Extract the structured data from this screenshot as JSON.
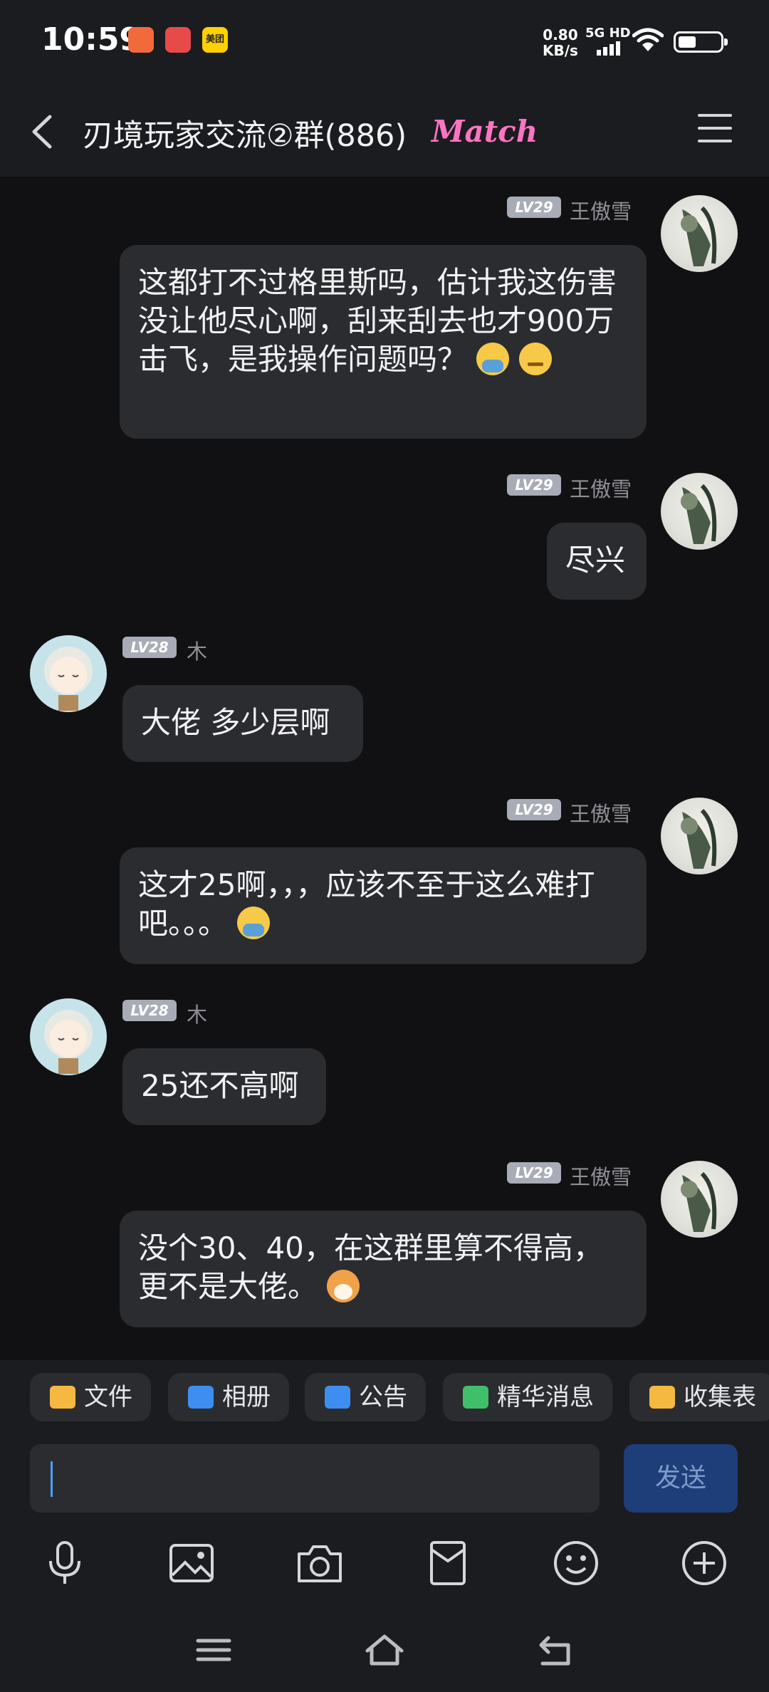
{
  "status_bar": {
    "time": "10:59",
    "net_speed_value": "0.80",
    "net_speed_unit": "KB/s",
    "net_type": "5G HD",
    "notification_apps": [
      "app-icon-1",
      "app-icon-2",
      "meituan-icon"
    ],
    "meituan_label": "美团"
  },
  "header": {
    "title": "刃境玩家交流②群(886)",
    "tag": "Match"
  },
  "messages": [
    {
      "sender": "王傲雪",
      "level": "LV29",
      "text": "这都打不过格里斯吗，估计我这伤害没让他尽心啊，刮来刮去也才900万击飞，是我操作问题吗？"
    },
    {
      "sender": "王傲雪",
      "level": "LV29",
      "text": "尽兴"
    },
    {
      "sender": "木",
      "level": "LV28",
      "text": "大佬 多少层啊"
    },
    {
      "sender": "王傲雪",
      "level": "LV29",
      "text": "这才25啊，，，应该不至于这么难打吧。。。"
    },
    {
      "sender": "木",
      "level": "LV28",
      "text": "25还不高啊"
    },
    {
      "sender": "王傲雪",
      "level": "LV29",
      "text": "没个30、40，在这群里算不得高，更不是大佬。"
    }
  ],
  "quick_actions": [
    {
      "label": "文件",
      "icon": "folder-icon",
      "color": "#f5b942"
    },
    {
      "label": "相册",
      "icon": "album-icon",
      "color": "#3d8ef0"
    },
    {
      "label": "公告",
      "icon": "announcement-icon",
      "color": "#3d8ef0"
    },
    {
      "label": "精华消息",
      "icon": "essence-icon",
      "color": "#3fbf6a"
    },
    {
      "label": "收集表",
      "icon": "clipboard-icon",
      "color": "#f5b942"
    }
  ],
  "composer": {
    "input_value": "",
    "send_label": "发送"
  },
  "toolbar": [
    "microphone-icon",
    "image-icon",
    "camera-icon",
    "red-packet-icon",
    "emoji-icon",
    "plus-icon"
  ],
  "navbar": [
    "menu-icon",
    "home-icon",
    "back-icon"
  ]
}
